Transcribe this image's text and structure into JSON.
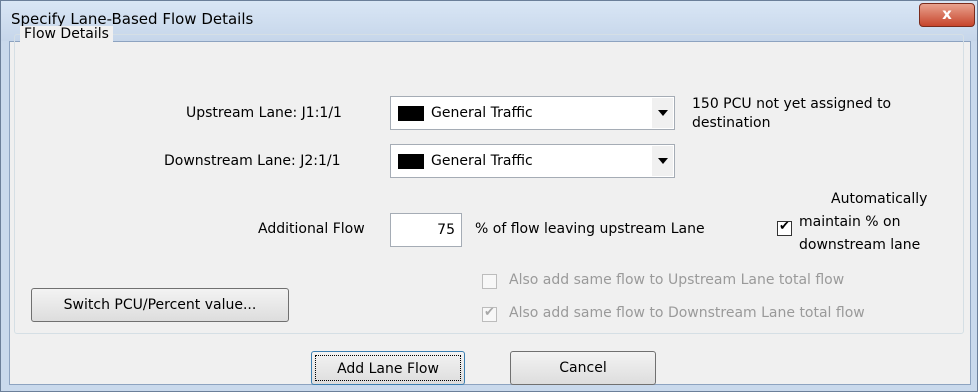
{
  "window": {
    "title": "Specify Lane-Based Flow Details",
    "close_glyph": "x"
  },
  "group": {
    "legend": "Flow Details"
  },
  "upstream": {
    "label": "Upstream Lane: J1:1/1",
    "selected": "General Traffic",
    "swatch_color": "#000000",
    "note": "150 PCU not yet assigned to destination"
  },
  "downstream": {
    "label": "Downstream Lane: J2:1/1",
    "selected": "General Traffic",
    "swatch_color": "#000000"
  },
  "additional": {
    "label": "Additional Flow",
    "value": "75",
    "suffix": "% of flow leaving upstream Lane"
  },
  "options": {
    "auto_maintain": {
      "label_line1": "Automatically",
      "label_line2": "maintain % on",
      "label_line3": "downstream lane",
      "checked": true
    },
    "add_upstream": {
      "label": "Also add same flow to Upstream Lane total flow",
      "checked": false,
      "enabled": false
    },
    "add_downstream": {
      "label": "Also add same flow to Downstream Lane total flow",
      "checked": true,
      "enabled": false
    }
  },
  "buttons": {
    "switch": "Switch PCU/Percent value...",
    "add_lane_flow": "Add Lane Flow",
    "cancel": "Cancel"
  }
}
